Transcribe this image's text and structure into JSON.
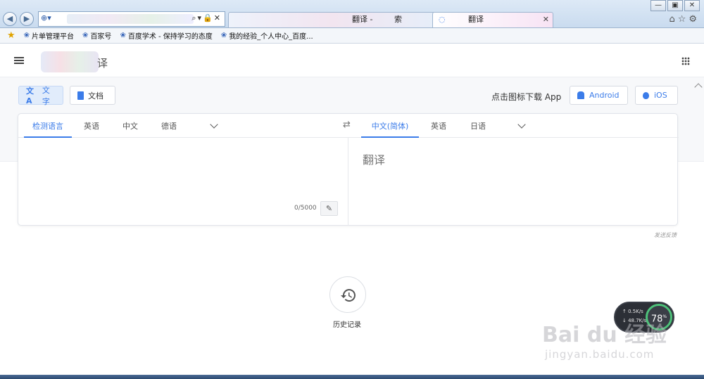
{
  "browser": {
    "tabs": [
      {
        "label": "翻译 - "
      },
      {
        "label": "索"
      },
      {
        "label": "翻译"
      }
    ],
    "window_controls": [
      "—",
      "▣",
      "✕"
    ],
    "toolbar_icons": "⌂☆⚙",
    "address_controls": "⌕▾🔒✕"
  },
  "favorites": [
    {
      "label": "片单管理平台"
    },
    {
      "label": "百家号"
    },
    {
      "label": "百度学术 - 保持学习的态度"
    },
    {
      "label": "我的经验_个人中心_百度..."
    }
  ],
  "header": {
    "logo_suffix": "译"
  },
  "modes": {
    "text_icon": "文A",
    "text_label": "文字",
    "doc_label": "文档"
  },
  "download": {
    "label": "点击图标下载 App",
    "android_label": "Android",
    "ios_label": "iOS"
  },
  "source": {
    "langs": [
      "检测语言",
      "英语",
      "中文",
      "德语"
    ],
    "char_count": "0/5000",
    "pencil": "✎"
  },
  "target": {
    "langs": [
      "中文(简体)",
      "英语",
      "日语"
    ],
    "placeholder": "翻译"
  },
  "swap_icon": "⇄",
  "feedback": "发送反馈",
  "history": {
    "label": "历史记录"
  },
  "net_widget": {
    "up": "↑ 0.5K/s",
    "down": "↓ 48.7K/s",
    "percent": "78",
    "percent_unit": "%",
    "ring_color": "#4ec27a"
  },
  "watermark": {
    "brand": "Bai du 经验",
    "url": "jingyan.baidu.com"
  },
  "colors": {
    "accent": "#3b7ce9"
  }
}
